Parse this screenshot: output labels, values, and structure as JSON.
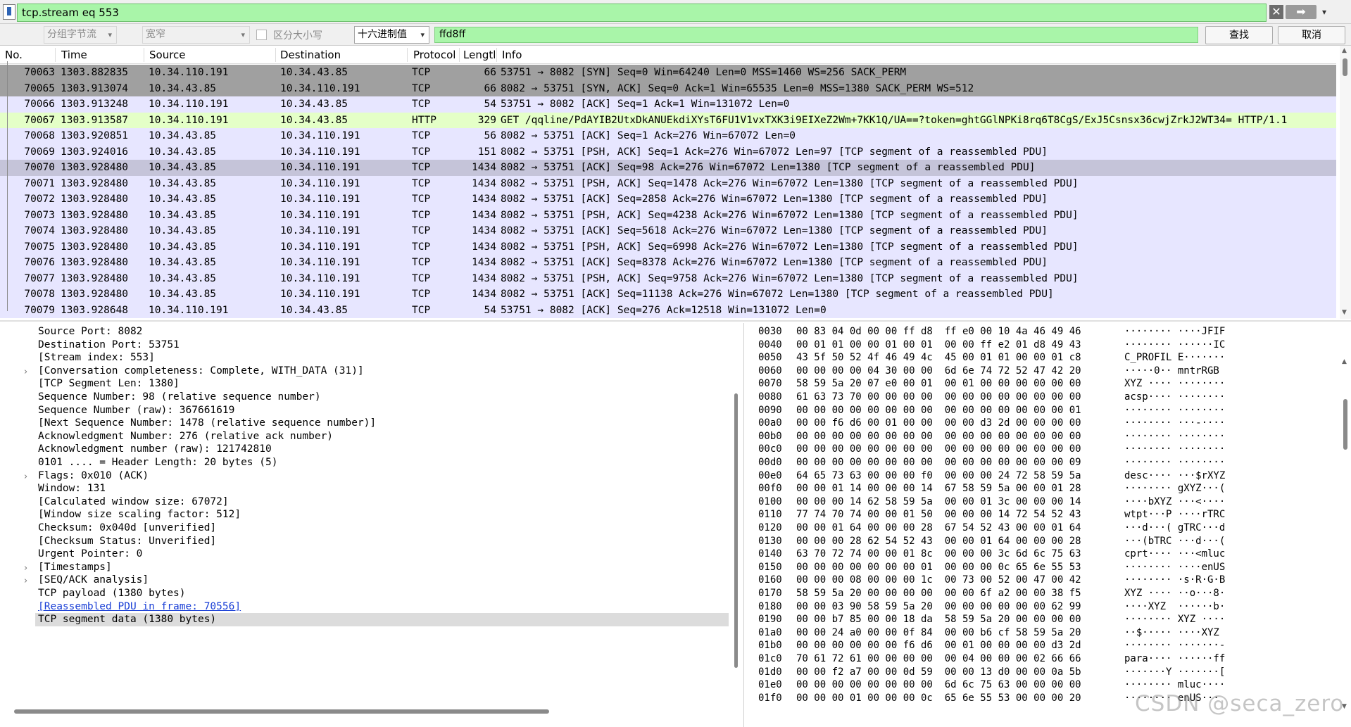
{
  "filter": {
    "value": "tcp.stream eq 553"
  },
  "find": {
    "search_in": "分组字节流",
    "char_width": "宽窄",
    "case_label": "区分大小写",
    "search_type": "十六进制值",
    "value": "ffd8ff",
    "find_button": "查找",
    "cancel_button": "取消"
  },
  "columns": [
    "No.",
    "Time",
    "Source",
    "Destination",
    "Protocol",
    "Lengtl",
    "Info"
  ],
  "packets": [
    {
      "no": "70063",
      "time": "1303.882835",
      "src": "10.34.110.191",
      "dst": "10.34.43.85",
      "proto": "TCP",
      "len": "66",
      "info": "53751 → 8082 [SYN] Seq=0 Win=64240 Len=0 MSS=1460 WS=256 SACK_PERM",
      "style": "syn"
    },
    {
      "no": "70065",
      "time": "1303.913074",
      "src": "10.34.43.85",
      "dst": "10.34.110.191",
      "proto": "TCP",
      "len": "66",
      "info": "8082 → 53751 [SYN, ACK] Seq=0 Ack=1 Win=65535 Len=0 MSS=1380 SACK_PERM WS=512",
      "style": "syn"
    },
    {
      "no": "70066",
      "time": "1303.913248",
      "src": "10.34.110.191",
      "dst": "10.34.43.85",
      "proto": "TCP",
      "len": "54",
      "info": "53751 → 8082 [ACK] Seq=1 Ack=1 Win=131072 Len=0",
      "style": "tcp"
    },
    {
      "no": "70067",
      "time": "1303.913587",
      "src": "10.34.110.191",
      "dst": "10.34.43.85",
      "proto": "HTTP",
      "len": "329",
      "info": "GET /qqline/PdAYIB2UtxDkANUEkdiXYsT6FU1V1vxTXK3i9EIXeZ2Wm+7KK1Q/UA==?token=ghtGGlNPKi8rq6T8CgS/ExJ5Csnsx36cwjZrkJ2WT34= HTTP/1.1",
      "style": "http"
    },
    {
      "no": "70068",
      "time": "1303.920851",
      "src": "10.34.43.85",
      "dst": "10.34.110.191",
      "proto": "TCP",
      "len": "56",
      "info": "8082 → 53751 [ACK] Seq=1 Ack=276 Win=67072 Len=0",
      "style": "tcp"
    },
    {
      "no": "70069",
      "time": "1303.924016",
      "src": "10.34.43.85",
      "dst": "10.34.110.191",
      "proto": "TCP",
      "len": "151",
      "info": "8082 → 53751 [PSH, ACK] Seq=1 Ack=276 Win=67072 Len=97 [TCP segment of a reassembled PDU]",
      "style": "tcp"
    },
    {
      "no": "70070",
      "time": "1303.928480",
      "src": "10.34.43.85",
      "dst": "10.34.110.191",
      "proto": "TCP",
      "len": "1434",
      "info": "8082 → 53751 [ACK] Seq=98 Ack=276 Win=67072 Len=1380 [TCP segment of a reassembled PDU]",
      "style": "sel"
    },
    {
      "no": "70071",
      "time": "1303.928480",
      "src": "10.34.43.85",
      "dst": "10.34.110.191",
      "proto": "TCP",
      "len": "1434",
      "info": "8082 → 53751 [PSH, ACK] Seq=1478 Ack=276 Win=67072 Len=1380 [TCP segment of a reassembled PDU]",
      "style": "tcp"
    },
    {
      "no": "70072",
      "time": "1303.928480",
      "src": "10.34.43.85",
      "dst": "10.34.110.191",
      "proto": "TCP",
      "len": "1434",
      "info": "8082 → 53751 [ACK] Seq=2858 Ack=276 Win=67072 Len=1380 [TCP segment of a reassembled PDU]",
      "style": "tcp"
    },
    {
      "no": "70073",
      "time": "1303.928480",
      "src": "10.34.43.85",
      "dst": "10.34.110.191",
      "proto": "TCP",
      "len": "1434",
      "info": "8082 → 53751 [PSH, ACK] Seq=4238 Ack=276 Win=67072 Len=1380 [TCP segment of a reassembled PDU]",
      "style": "tcp"
    },
    {
      "no": "70074",
      "time": "1303.928480",
      "src": "10.34.43.85",
      "dst": "10.34.110.191",
      "proto": "TCP",
      "len": "1434",
      "info": "8082 → 53751 [ACK] Seq=5618 Ack=276 Win=67072 Len=1380 [TCP segment of a reassembled PDU]",
      "style": "tcp"
    },
    {
      "no": "70075",
      "time": "1303.928480",
      "src": "10.34.43.85",
      "dst": "10.34.110.191",
      "proto": "TCP",
      "len": "1434",
      "info": "8082 → 53751 [PSH, ACK] Seq=6998 Ack=276 Win=67072 Len=1380 [TCP segment of a reassembled PDU]",
      "style": "tcp"
    },
    {
      "no": "70076",
      "time": "1303.928480",
      "src": "10.34.43.85",
      "dst": "10.34.110.191",
      "proto": "TCP",
      "len": "1434",
      "info": "8082 → 53751 [ACK] Seq=8378 Ack=276 Win=67072 Len=1380 [TCP segment of a reassembled PDU]",
      "style": "tcp"
    },
    {
      "no": "70077",
      "time": "1303.928480",
      "src": "10.34.43.85",
      "dst": "10.34.110.191",
      "proto": "TCP",
      "len": "1434",
      "info": "8082 → 53751 [PSH, ACK] Seq=9758 Ack=276 Win=67072 Len=1380 [TCP segment of a reassembled PDU]",
      "style": "tcp"
    },
    {
      "no": "70078",
      "time": "1303.928480",
      "src": "10.34.43.85",
      "dst": "10.34.110.191",
      "proto": "TCP",
      "len": "1434",
      "info": "8082 → 53751 [ACK] Seq=11138 Ack=276 Win=67072 Len=1380 [TCP segment of a reassembled PDU]",
      "style": "tcp"
    },
    {
      "no": "70079",
      "time": "1303.928648",
      "src": "10.34.110.191",
      "dst": "10.34.43.85",
      "proto": "TCP",
      "len": "54",
      "info": "53751 → 8082 [ACK] Seq=276 Ack=12518 Win=131072 Len=0",
      "style": "tcp"
    }
  ],
  "details": [
    {
      "text": "Source Port: 8082",
      "expandable": false
    },
    {
      "text": "Destination Port: 53751",
      "expandable": false
    },
    {
      "text": "[Stream index: 553]",
      "expandable": false
    },
    {
      "text": "[Conversation completeness: Complete, WITH_DATA (31)]",
      "expandable": true
    },
    {
      "text": "[TCP Segment Len: 1380]",
      "expandable": false
    },
    {
      "text": "Sequence Number: 98    (relative sequence number)",
      "expandable": false
    },
    {
      "text": "Sequence Number (raw): 367661619",
      "expandable": false
    },
    {
      "text": "[Next Sequence Number: 1478    (relative sequence number)]",
      "expandable": false
    },
    {
      "text": "Acknowledgment Number: 276    (relative ack number)",
      "expandable": false
    },
    {
      "text": "Acknowledgment number (raw): 121742810",
      "expandable": false
    },
    {
      "text": "0101 .... = Header Length: 20 bytes (5)",
      "expandable": false
    },
    {
      "text": "Flags: 0x010 (ACK)",
      "expandable": true
    },
    {
      "text": "Window: 131",
      "expandable": false
    },
    {
      "text": "[Calculated window size: 67072]",
      "expandable": false
    },
    {
      "text": "[Window size scaling factor: 512]",
      "expandable": false
    },
    {
      "text": "Checksum: 0x040d [unverified]",
      "expandable": false
    },
    {
      "text": "[Checksum Status: Unverified]",
      "expandable": false
    },
    {
      "text": "Urgent Pointer: 0",
      "expandable": false
    },
    {
      "text": "[Timestamps]",
      "expandable": true
    },
    {
      "text": "[SEQ/ACK analysis]",
      "expandable": true
    },
    {
      "text": "TCP payload (1380 bytes)",
      "expandable": false
    },
    {
      "text": "[Reassembled PDU in frame: 70556]",
      "expandable": false,
      "link": true
    },
    {
      "text": "TCP segment data (1380 bytes)",
      "expandable": false,
      "highlight": true
    }
  ],
  "bytes": [
    {
      "off": "0030",
      "hex": "00 83 04 0d 00 00 ff d8  ff e0 00 10 4a 46 49 46",
      "asc": "········ ····JFIF"
    },
    {
      "off": "0040",
      "hex": "00 01 01 00 00 01 00 01  00 00 ff e2 01 d8 49 43",
      "asc": "········ ······IC"
    },
    {
      "off": "0050",
      "hex": "43 5f 50 52 4f 46 49 4c  45 00 01 01 00 00 01 c8",
      "asc": "C_PROFIL E·······"
    },
    {
      "off": "0060",
      "hex": "00 00 00 00 04 30 00 00  6d 6e 74 72 52 47 42 20",
      "asc": "·····0·· mntrRGB "
    },
    {
      "off": "0070",
      "hex": "58 59 5a 20 07 e0 00 01  00 01 00 00 00 00 00 00",
      "asc": "XYZ ···· ········"
    },
    {
      "off": "0080",
      "hex": "61 63 73 70 00 00 00 00  00 00 00 00 00 00 00 00",
      "asc": "acsp···· ········"
    },
    {
      "off": "0090",
      "hex": "00 00 00 00 00 00 00 00  00 00 00 00 00 00 00 01",
      "asc": "········ ········"
    },
    {
      "off": "00a0",
      "hex": "00 00 f6 d6 00 01 00 00  00 00 d3 2d 00 00 00 00",
      "asc": "········ ···-····"
    },
    {
      "off": "00b0",
      "hex": "00 00 00 00 00 00 00 00  00 00 00 00 00 00 00 00",
      "asc": "········ ········"
    },
    {
      "off": "00c0",
      "hex": "00 00 00 00 00 00 00 00  00 00 00 00 00 00 00 00",
      "asc": "········ ········"
    },
    {
      "off": "00d0",
      "hex": "00 00 00 00 00 00 00 00  00 00 00 00 00 00 00 09",
      "asc": "········ ········"
    },
    {
      "off": "00e0",
      "hex": "64 65 73 63 00 00 00 f0  00 00 00 24 72 58 59 5a",
      "asc": "desc···· ···$rXYZ"
    },
    {
      "off": "00f0",
      "hex": "00 00 01 14 00 00 00 14  67 58 59 5a 00 00 01 28",
      "asc": "········ gXYZ···("
    },
    {
      "off": "0100",
      "hex": "00 00 00 14 62 58 59 5a  00 00 01 3c 00 00 00 14",
      "asc": "····bXYZ ···<····"
    },
    {
      "off": "0110",
      "hex": "77 74 70 74 00 00 01 50  00 00 00 14 72 54 52 43",
      "asc": "wtpt···P ····rTRC"
    },
    {
      "off": "0120",
      "hex": "00 00 01 64 00 00 00 28  67 54 52 43 00 00 01 64",
      "asc": "···d···( gTRC···d"
    },
    {
      "off": "0130",
      "hex": "00 00 00 28 62 54 52 43  00 00 01 64 00 00 00 28",
      "asc": "···(bTRC ···d···("
    },
    {
      "off": "0140",
      "hex": "63 70 72 74 00 00 01 8c  00 00 00 3c 6d 6c 75 63",
      "asc": "cprt···· ···<mluc"
    },
    {
      "off": "0150",
      "hex": "00 00 00 00 00 00 00 01  00 00 00 0c 65 6e 55 53",
      "asc": "········ ····enUS"
    },
    {
      "off": "0160",
      "hex": "00 00 00 08 00 00 00 1c  00 73 00 52 00 47 00 42",
      "asc": "········ ·s·R·G·B"
    },
    {
      "off": "0170",
      "hex": "58 59 5a 20 00 00 00 00  00 00 6f a2 00 00 38 f5",
      "asc": "XYZ ···· ··o···8·"
    },
    {
      "off": "0180",
      "hex": "00 00 03 90 58 59 5a 20  00 00 00 00 00 00 62 99",
      "asc": "····XYZ  ······b·"
    },
    {
      "off": "0190",
      "hex": "00 00 b7 85 00 00 18 da  58 59 5a 20 00 00 00 00",
      "asc": "········ XYZ ····"
    },
    {
      "off": "01a0",
      "hex": "00 00 24 a0 00 00 0f 84  00 00 b6 cf 58 59 5a 20",
      "asc": "··$····· ····XYZ "
    },
    {
      "off": "01b0",
      "hex": "00 00 00 00 00 00 f6 d6  00 01 00 00 00 00 d3 2d",
      "asc": "········ ·······-"
    },
    {
      "off": "01c0",
      "hex": "70 61 72 61 00 00 00 00  00 04 00 00 00 02 66 66",
      "asc": "para···· ······ff"
    },
    {
      "off": "01d0",
      "hex": "00 00 f2 a7 00 00 0d 59  00 00 13 d0 00 00 0a 5b",
      "asc": "·······Y ·······["
    },
    {
      "off": "01e0",
      "hex": "00 00 00 00 00 00 00 00  6d 6c 75 63 00 00 00 00",
      "asc": "········ mluc····"
    },
    {
      "off": "01f0",
      "hex": "00 00 00 01 00 00 00 0c  65 6e 55 53 00 00 00 20",
      "asc": "········ enUS··· "
    }
  ],
  "watermark": "CSDN @seca_zero"
}
